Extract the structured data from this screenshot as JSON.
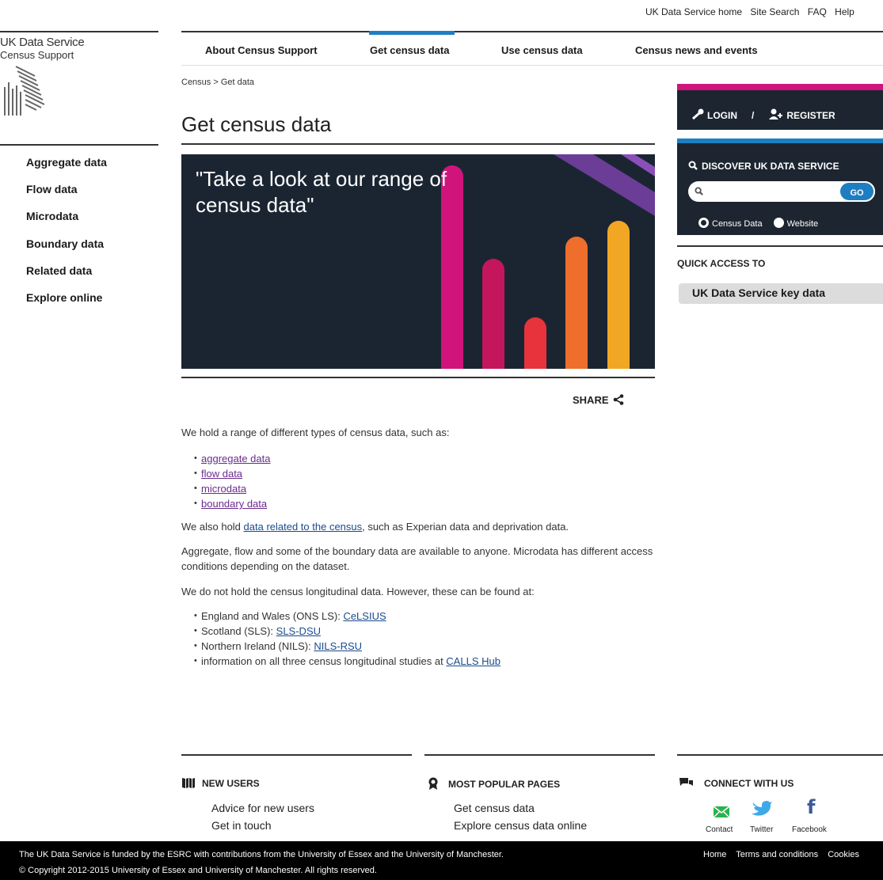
{
  "util_nav": [
    "UK Data Service home",
    "Site Search",
    "FAQ",
    "Help"
  ],
  "logo": {
    "title": "UK Data Service",
    "subtitle": "Census Support",
    "mark_icon": "uk-data-service-logo-icon"
  },
  "main_nav": {
    "items": [
      "About Census Support",
      "Get census data",
      "Use census data",
      "Census news and events"
    ],
    "active": "Get census data",
    "active_color": "#1d7fc1"
  },
  "sidebar": {
    "items": [
      "Aggregate data",
      "Flow data",
      "Microdata",
      "Boundary data",
      "Related data",
      "Explore online"
    ]
  },
  "breadcrumb": "Census > Get data",
  "page_title": "Get census data",
  "banner": {
    "quote": "\"Take a look at our range of census data\"",
    "background": "#1b2532",
    "bar_colors": [
      "#d0147c",
      "#c4165d",
      "#e8333c",
      "#ef6e2b",
      "#f2a724"
    ]
  },
  "share_label": "SHARE",
  "content": {
    "intro": "We hold a range of different types of census data, such as:",
    "types": [
      "aggregate data",
      "flow data",
      "microdata",
      "boundary data"
    ],
    "related_prefix": "We also hold ",
    "related_link": "data related to the census",
    "related_suffix": ", such as Experian data and deprivation data.",
    "access": "Aggregate, flow and some of the boundary data are available to anyone. Microdata has different access conditions depending on the dataset.",
    "longitudinal_intro": "We do not hold the census longitudinal data. However, these can be found at:",
    "longitudinal": [
      {
        "prefix": "England and Wales (ONS LS): ",
        "link": "CeLSIUS"
      },
      {
        "prefix": "Scotland (SLS): ",
        "link": "SLS-DSU"
      },
      {
        "prefix": "Northern Ireland (NILS): ",
        "link": "NILS-RSU"
      },
      {
        "prefix": "information on all three census longitudinal studies at ",
        "link": "CALLS Hub"
      }
    ]
  },
  "account": {
    "login": "LOGIN",
    "separator": "/",
    "register": "REGISTER",
    "accent": "#d0147c"
  },
  "discover": {
    "title": "DISCOVER UK DATA SERVICE",
    "search_placeholder": "",
    "go": "GO",
    "radio_census": "Census Data",
    "radio_website": "Website",
    "selected": "Census Data"
  },
  "quick_access": {
    "title": "QUICK ACCESS TO",
    "button": "UK Data Service key data"
  },
  "footer": {
    "new_users": {
      "title": "NEW USERS",
      "links": [
        "Advice for new users",
        "Get in touch"
      ]
    },
    "popular": {
      "title": "MOST POPULAR PAGES",
      "links": [
        "Get census data",
        "Explore census data online"
      ]
    },
    "connect": {
      "title": "CONNECT WITH US",
      "contact": "Contact",
      "twitter": "Twitter",
      "facebook": "Facebook"
    }
  },
  "bottom_bar": {
    "funding": "The UK Data Service is funded by the ESRC with contributions from the University of Essex and the University of Manchester.",
    "copyright": "© Copyright 2012-2015 University of Essex and University of Manchester. All rights reserved.",
    "links": [
      "Home",
      "Terms and conditions",
      "Cookies"
    ]
  }
}
